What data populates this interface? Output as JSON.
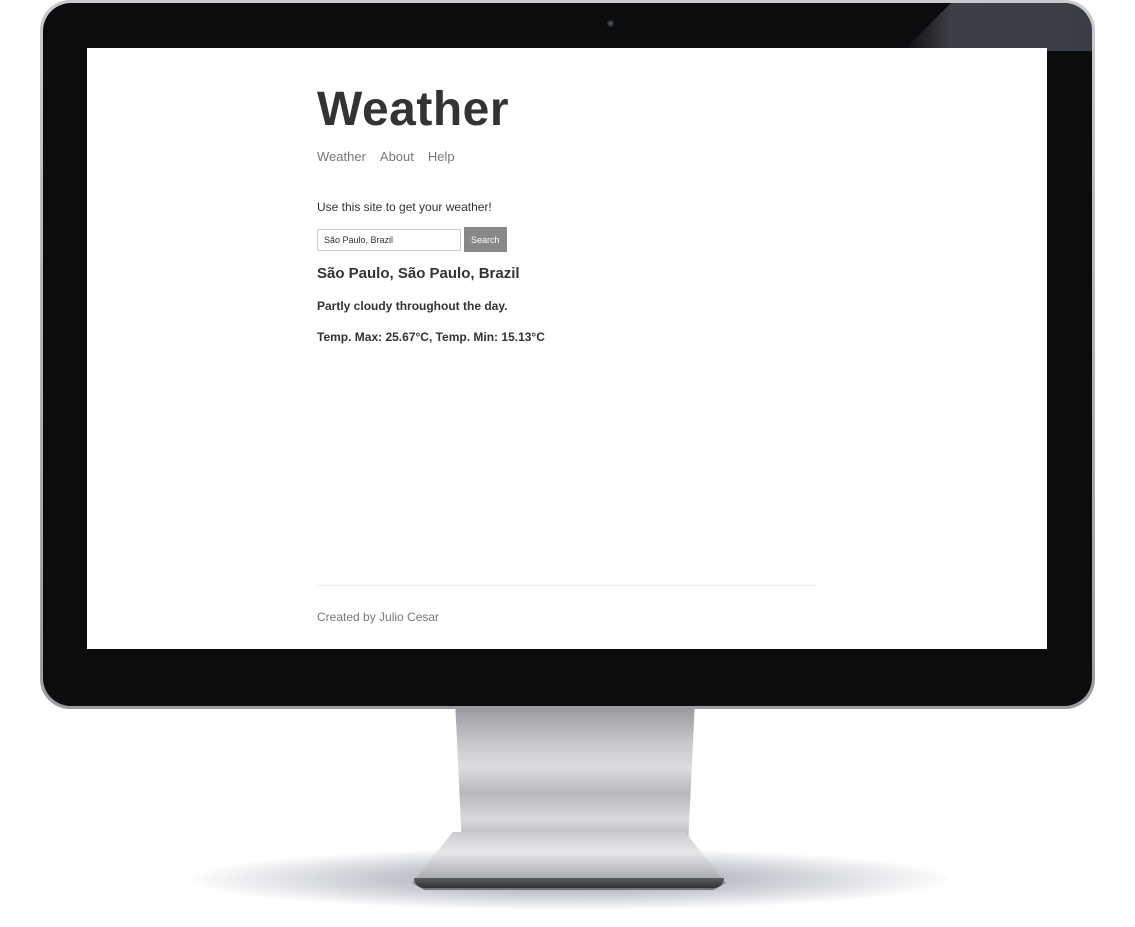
{
  "site": {
    "title": "Weather"
  },
  "nav": {
    "items": [
      {
        "label": "Weather"
      },
      {
        "label": "About"
      },
      {
        "label": "Help"
      }
    ]
  },
  "main": {
    "intro": "Use this site to get your weather!",
    "search": {
      "value": "São Paulo, Brazil",
      "button_label": "Search"
    },
    "result": {
      "location": "São Paulo, São Paulo, Brazil",
      "forecast": "Partly cloudy throughout the day.",
      "temperatures": "Temp. Max: 25.67°C, Temp. Min: 15.13°C"
    }
  },
  "footer": {
    "text": "Created by Julio Cesar"
  },
  "colors": {
    "title": "#333333",
    "nav": "#777777",
    "button_bg": "#888888",
    "bezel": "#0b0c0e"
  }
}
